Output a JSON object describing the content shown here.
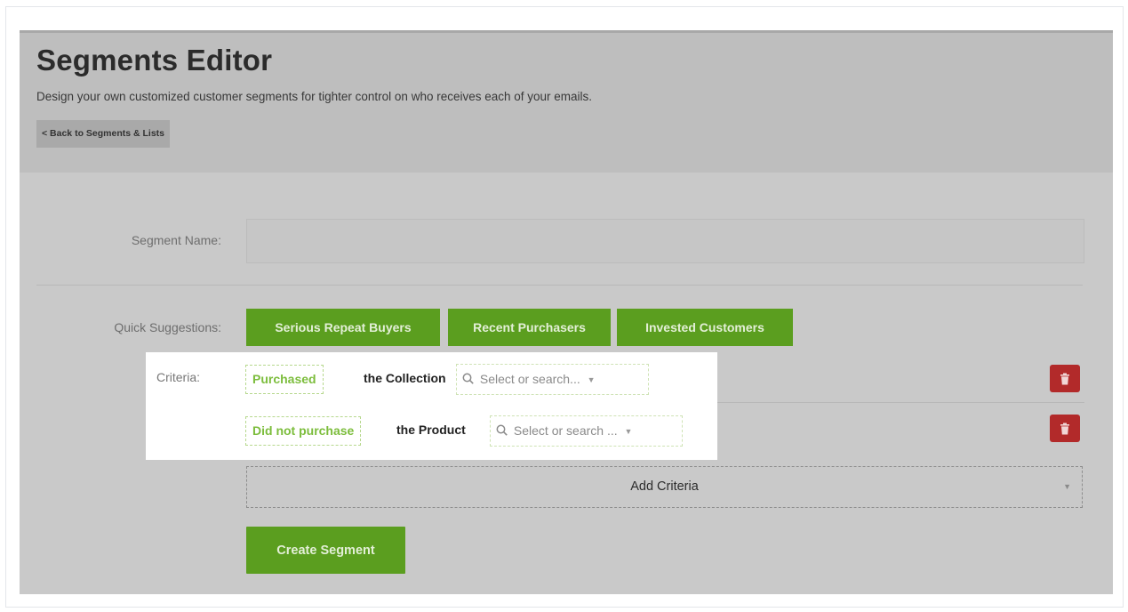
{
  "header": {
    "title": "Segments Editor",
    "subtitle": "Design your own customized customer segments for tighter control on who receives each of your emails.",
    "back_label": "< Back to Segments & Lists"
  },
  "form": {
    "segment_name_label": "Segment Name:",
    "segment_name_value": "",
    "quick_suggestions_label": "Quick Suggestions:",
    "suggestions": [
      "Serious Repeat Buyers",
      "Recent Purchasers",
      "Invested Customers"
    ],
    "criteria_label": "Criteria:",
    "criteria": [
      {
        "condition": "Purchased",
        "target": "the Collection",
        "select_placeholder": "Select or search...",
        "select_icon": "search-icon"
      },
      {
        "condition": "Did not purchase",
        "target": "the Product",
        "select_placeholder": "Select or search ...",
        "select_icon": "search-icon"
      }
    ],
    "add_criteria_label": "Add Criteria",
    "create_label": "Create Segment"
  },
  "colors": {
    "primary_green": "#5b9e1f",
    "tag_green": "#7cbd3c",
    "danger_red": "#b22a2a",
    "overlay_gray": "#c9c9c9"
  }
}
